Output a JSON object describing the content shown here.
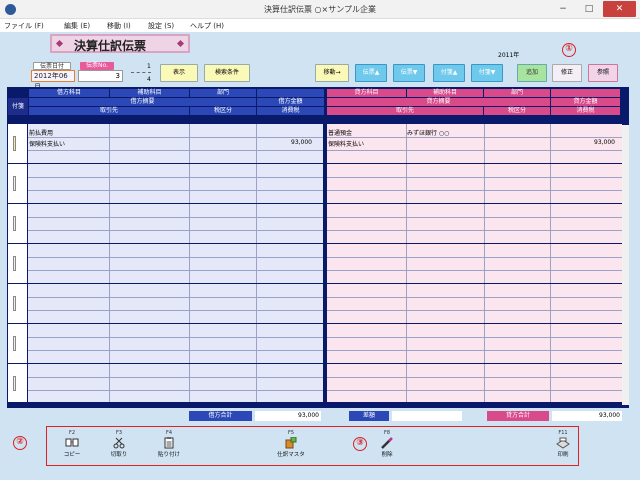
{
  "window": {
    "title": "決算仕訳伝票 ○×サンプル企業",
    "min": "−",
    "max": "□",
    "close": "✕"
  },
  "menu": [
    "ファイル (F)",
    "編集 (E)",
    "移動 (I)",
    "設定 (S)",
    "ヘルプ (H)"
  ],
  "page_title": "決算仕訳伝票",
  "voucher": {
    "date_label": "伝票日付",
    "no_label": "伝票No.",
    "date": "2012年06月",
    "no": "3",
    "page": "1",
    "pages": "4"
  },
  "buttons": {
    "show": "表示",
    "search": "検索条件",
    "move": "移動→",
    "voucher_up": "伝票▲",
    "voucher_down": "伝票▼",
    "tag_up": "付箋▲",
    "tag_down": "付箋▼",
    "add": "追加",
    "edit": "修正",
    "ref": "参照"
  },
  "year": "2011年",
  "annotations": {
    "c1": "①",
    "c2": "②",
    "c3": "③"
  },
  "headers": {
    "debit_account": "借方科目",
    "debit_sub": "補助科目",
    "debit_dept": "部門",
    "debit_summary": "借方摘要",
    "debit_amount": "借方金額",
    "tag": "付箋",
    "partner": "取引先",
    "tax_class": "税区分",
    "tax": "消費税",
    "credit_account": "貸方科目",
    "credit_sub": "補助科目",
    "credit_dept": "部門",
    "credit_summary": "貸方摘要",
    "credit_amount": "貸方金額",
    "partner_r": "取引先",
    "tax_class_r": "税区分",
    "tax_r": "消費税"
  },
  "row1": {
    "debit_account": "前払費用",
    "debit_summary": "保険料支払い",
    "debit_amount": "93,000",
    "credit_account": "普通預金",
    "credit_sub": "みずほ銀行 ○○",
    "credit_summary": "保険料支払い",
    "credit_amount": "93,000"
  },
  "footer": {
    "debit_total_label": "借方合計",
    "debit_total": "93,000",
    "diff_label": "差額",
    "diff": "",
    "credit_total_label": "貸方合計",
    "credit_total": "93,000"
  },
  "toolbar": [
    {
      "key": "F2",
      "label": "コピー"
    },
    {
      "key": "F3",
      "label": "切取り"
    },
    {
      "key": "F4",
      "label": "貼り付け"
    },
    {
      "key": "F5",
      "label": "仕訳マスタ"
    },
    {
      "key": "F8",
      "label": "削除"
    },
    {
      "key": "F11",
      "label": "印刷"
    }
  ]
}
